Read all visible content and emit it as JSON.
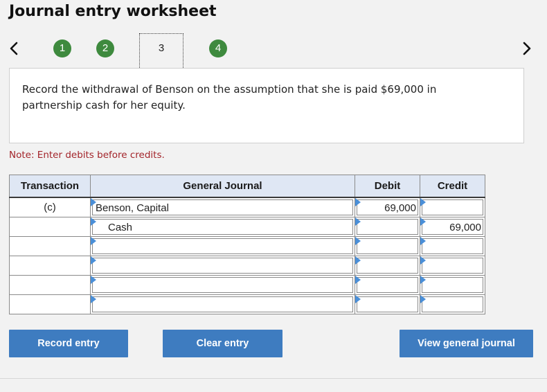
{
  "header": {
    "title": "Journal entry worksheet"
  },
  "navigation": {
    "prev_icon": "chevron-left-icon",
    "next_icon": "chevron-right-icon",
    "steps": [
      {
        "label": "1",
        "state": "completed"
      },
      {
        "label": "2",
        "state": "completed"
      },
      {
        "label": "3",
        "state": "current"
      },
      {
        "label": "4",
        "state": "completed"
      }
    ],
    "completed_color": "#3e8a3e"
  },
  "prompt": {
    "text": "Record the withdrawal of Benson on the assumption that she is paid $69,000 in partnership cash for her equity."
  },
  "note": {
    "text": "Note: Enter debits before credits.",
    "color": "#a3242a"
  },
  "table": {
    "headers": {
      "transaction": "Transaction",
      "general_journal": "General Journal",
      "debit": "Debit",
      "credit": "Credit"
    },
    "header_background": "#dfe7f4",
    "rows": [
      {
        "transaction": "(c)",
        "account": "Benson, Capital",
        "debit": "69,000",
        "credit": ""
      },
      {
        "transaction": "",
        "account": "Cash",
        "debit": "",
        "credit": "69,000"
      },
      {
        "transaction": "",
        "account": "",
        "debit": "",
        "credit": ""
      },
      {
        "transaction": "",
        "account": "",
        "debit": "",
        "credit": ""
      },
      {
        "transaction": "",
        "account": "",
        "debit": "",
        "credit": ""
      },
      {
        "transaction": "",
        "account": "",
        "debit": "",
        "credit": ""
      }
    ]
  },
  "buttons": {
    "record_entry": "Record entry",
    "clear_entry": "Clear entry",
    "view_general_journal": "View general journal",
    "color": "#3e7cc0"
  }
}
